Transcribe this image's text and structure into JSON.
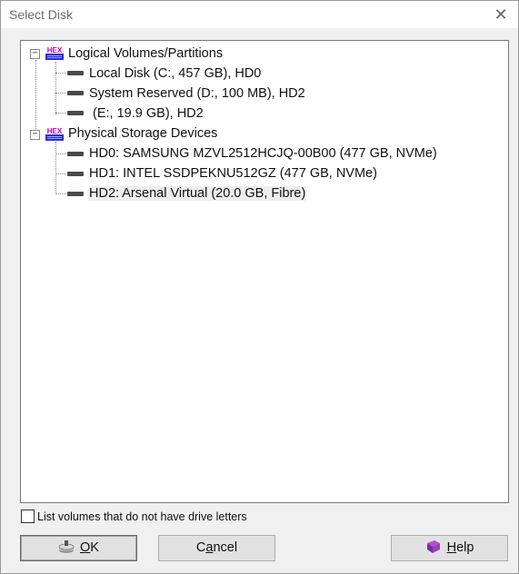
{
  "dialog": {
    "title": "Select Disk",
    "close_label": "✕"
  },
  "tree": {
    "groups": [
      {
        "label": "Logical Volumes/Partitions",
        "expander": "−",
        "items": [
          {
            "label": "Local Disk (C:, 457 GB), HD0"
          },
          {
            "label": "System Reserved (D:, 100 MB), HD2"
          },
          {
            "label": " (E:, 19.9 GB), HD2"
          }
        ]
      },
      {
        "label": "Physical Storage Devices",
        "expander": "−",
        "items": [
          {
            "label": "HD0: SAMSUNG MZVL2512HCJQ-00B00 (477 GB, NVMe)"
          },
          {
            "label": "HD1: INTEL SSDPEKNU512GZ (477 GB, NVMe)"
          },
          {
            "label": "HD2: Arsenal Virtual (20.0 GB, Fibre)",
            "selected": true
          }
        ]
      }
    ]
  },
  "options": {
    "list_no_letters_label": "List volumes that do not have drive letters",
    "list_no_letters_checked": false
  },
  "buttons": {
    "ok_accel": "O",
    "ok_rest": "K",
    "cancel_pre": "C",
    "cancel_accel": "a",
    "cancel_rest": "ncel",
    "help_accel": "H",
    "help_rest": "elp"
  },
  "icons": {
    "group_icon": "hex-app-icon",
    "drive_icon": "drive-icon",
    "ok_icon": "disk-drive-icon",
    "help_icon": "help-book-icon"
  }
}
